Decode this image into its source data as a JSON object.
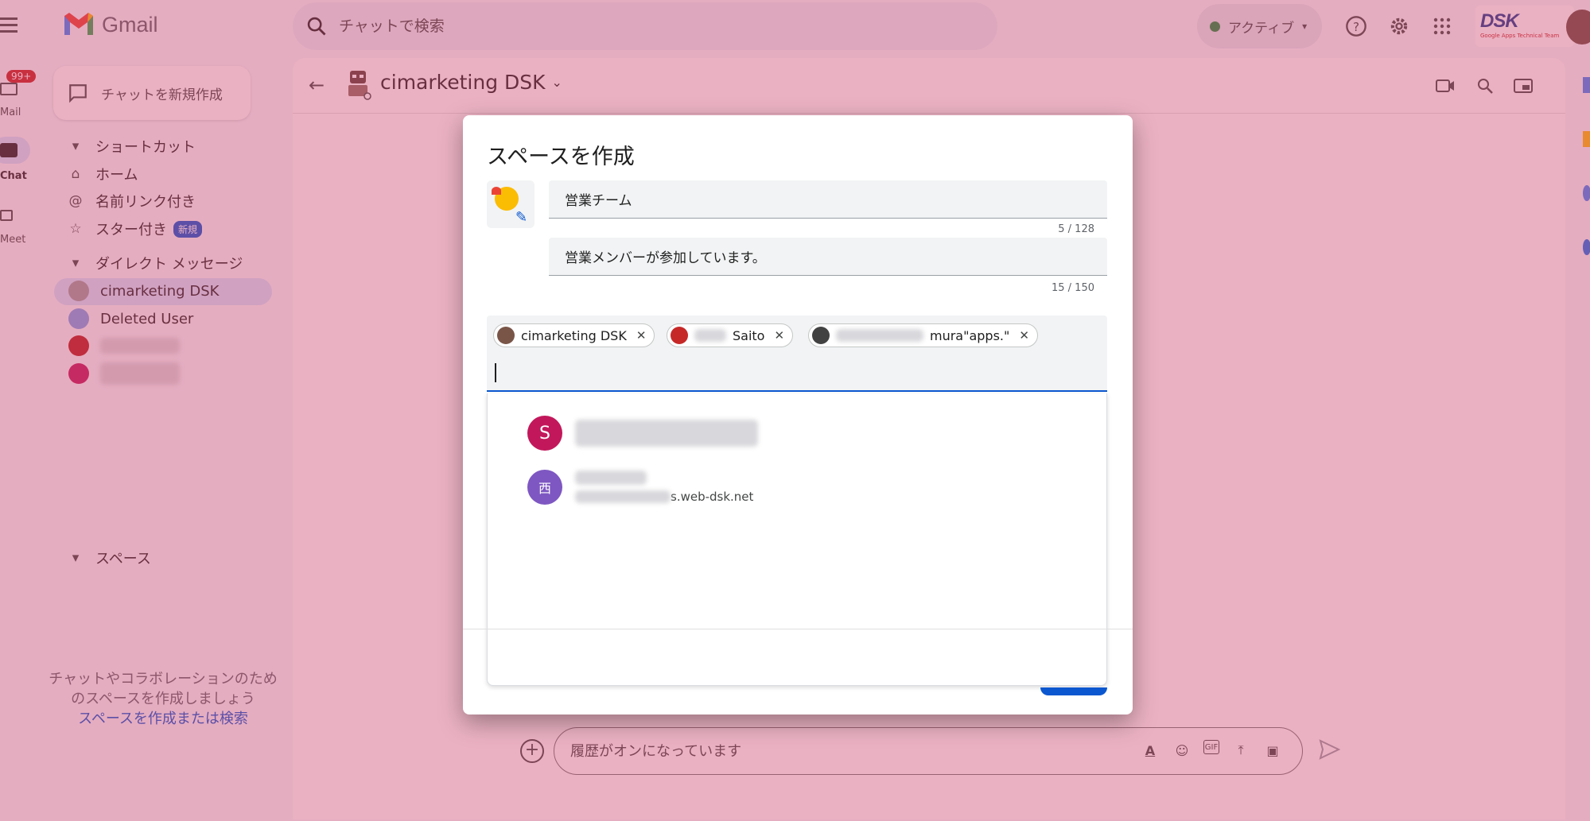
{
  "app": {
    "name": "Gmail"
  },
  "search": {
    "placeholder": "チャットで検索"
  },
  "status": {
    "label": "アクティブ"
  },
  "rail": {
    "mail_label": "Mail",
    "mail_badge": "99+",
    "chat_label": "Chat",
    "meet_label": "Meet"
  },
  "sidebar": {
    "compose_label": "チャットを新規作成",
    "shortcuts_header": "ショートカット",
    "home": "ホーム",
    "mentions": "名前リンク付き",
    "starred": "スター付き",
    "starred_badge": "新規",
    "dm_header": "ダイレクト メッセージ",
    "dms": [
      {
        "name": "cimarketing DSK"
      },
      {
        "name": "Deleted User"
      }
    ],
    "spaces_header": "スペース",
    "empty_text": "チャットやコラボレーションのためのスペースを作成しましょう",
    "empty_link": "スペースを作成または検索"
  },
  "chat": {
    "title": "cimarketing DSK",
    "composer_placeholder": "履歴がオンになっています"
  },
  "dialog": {
    "title": "スペースを作成",
    "name_value": "営業チーム",
    "name_counter": "5 / 128",
    "desc_value": "営業メンバーが参加しています。",
    "desc_counter": "15 / 150",
    "chips": [
      {
        "label": "cimarketing DSK"
      },
      {
        "label": "Saito"
      },
      {
        "label": "mura\"apps.\""
      }
    ],
    "suggestions": [
      {
        "initial": "S",
        "color": "#c2185b"
      },
      {
        "initial": "西",
        "color": "#7e57c2",
        "email": "s.web-dsk.net"
      }
    ]
  },
  "colors": {
    "accent": "#0b57d0",
    "overlay": "#cd466e"
  }
}
